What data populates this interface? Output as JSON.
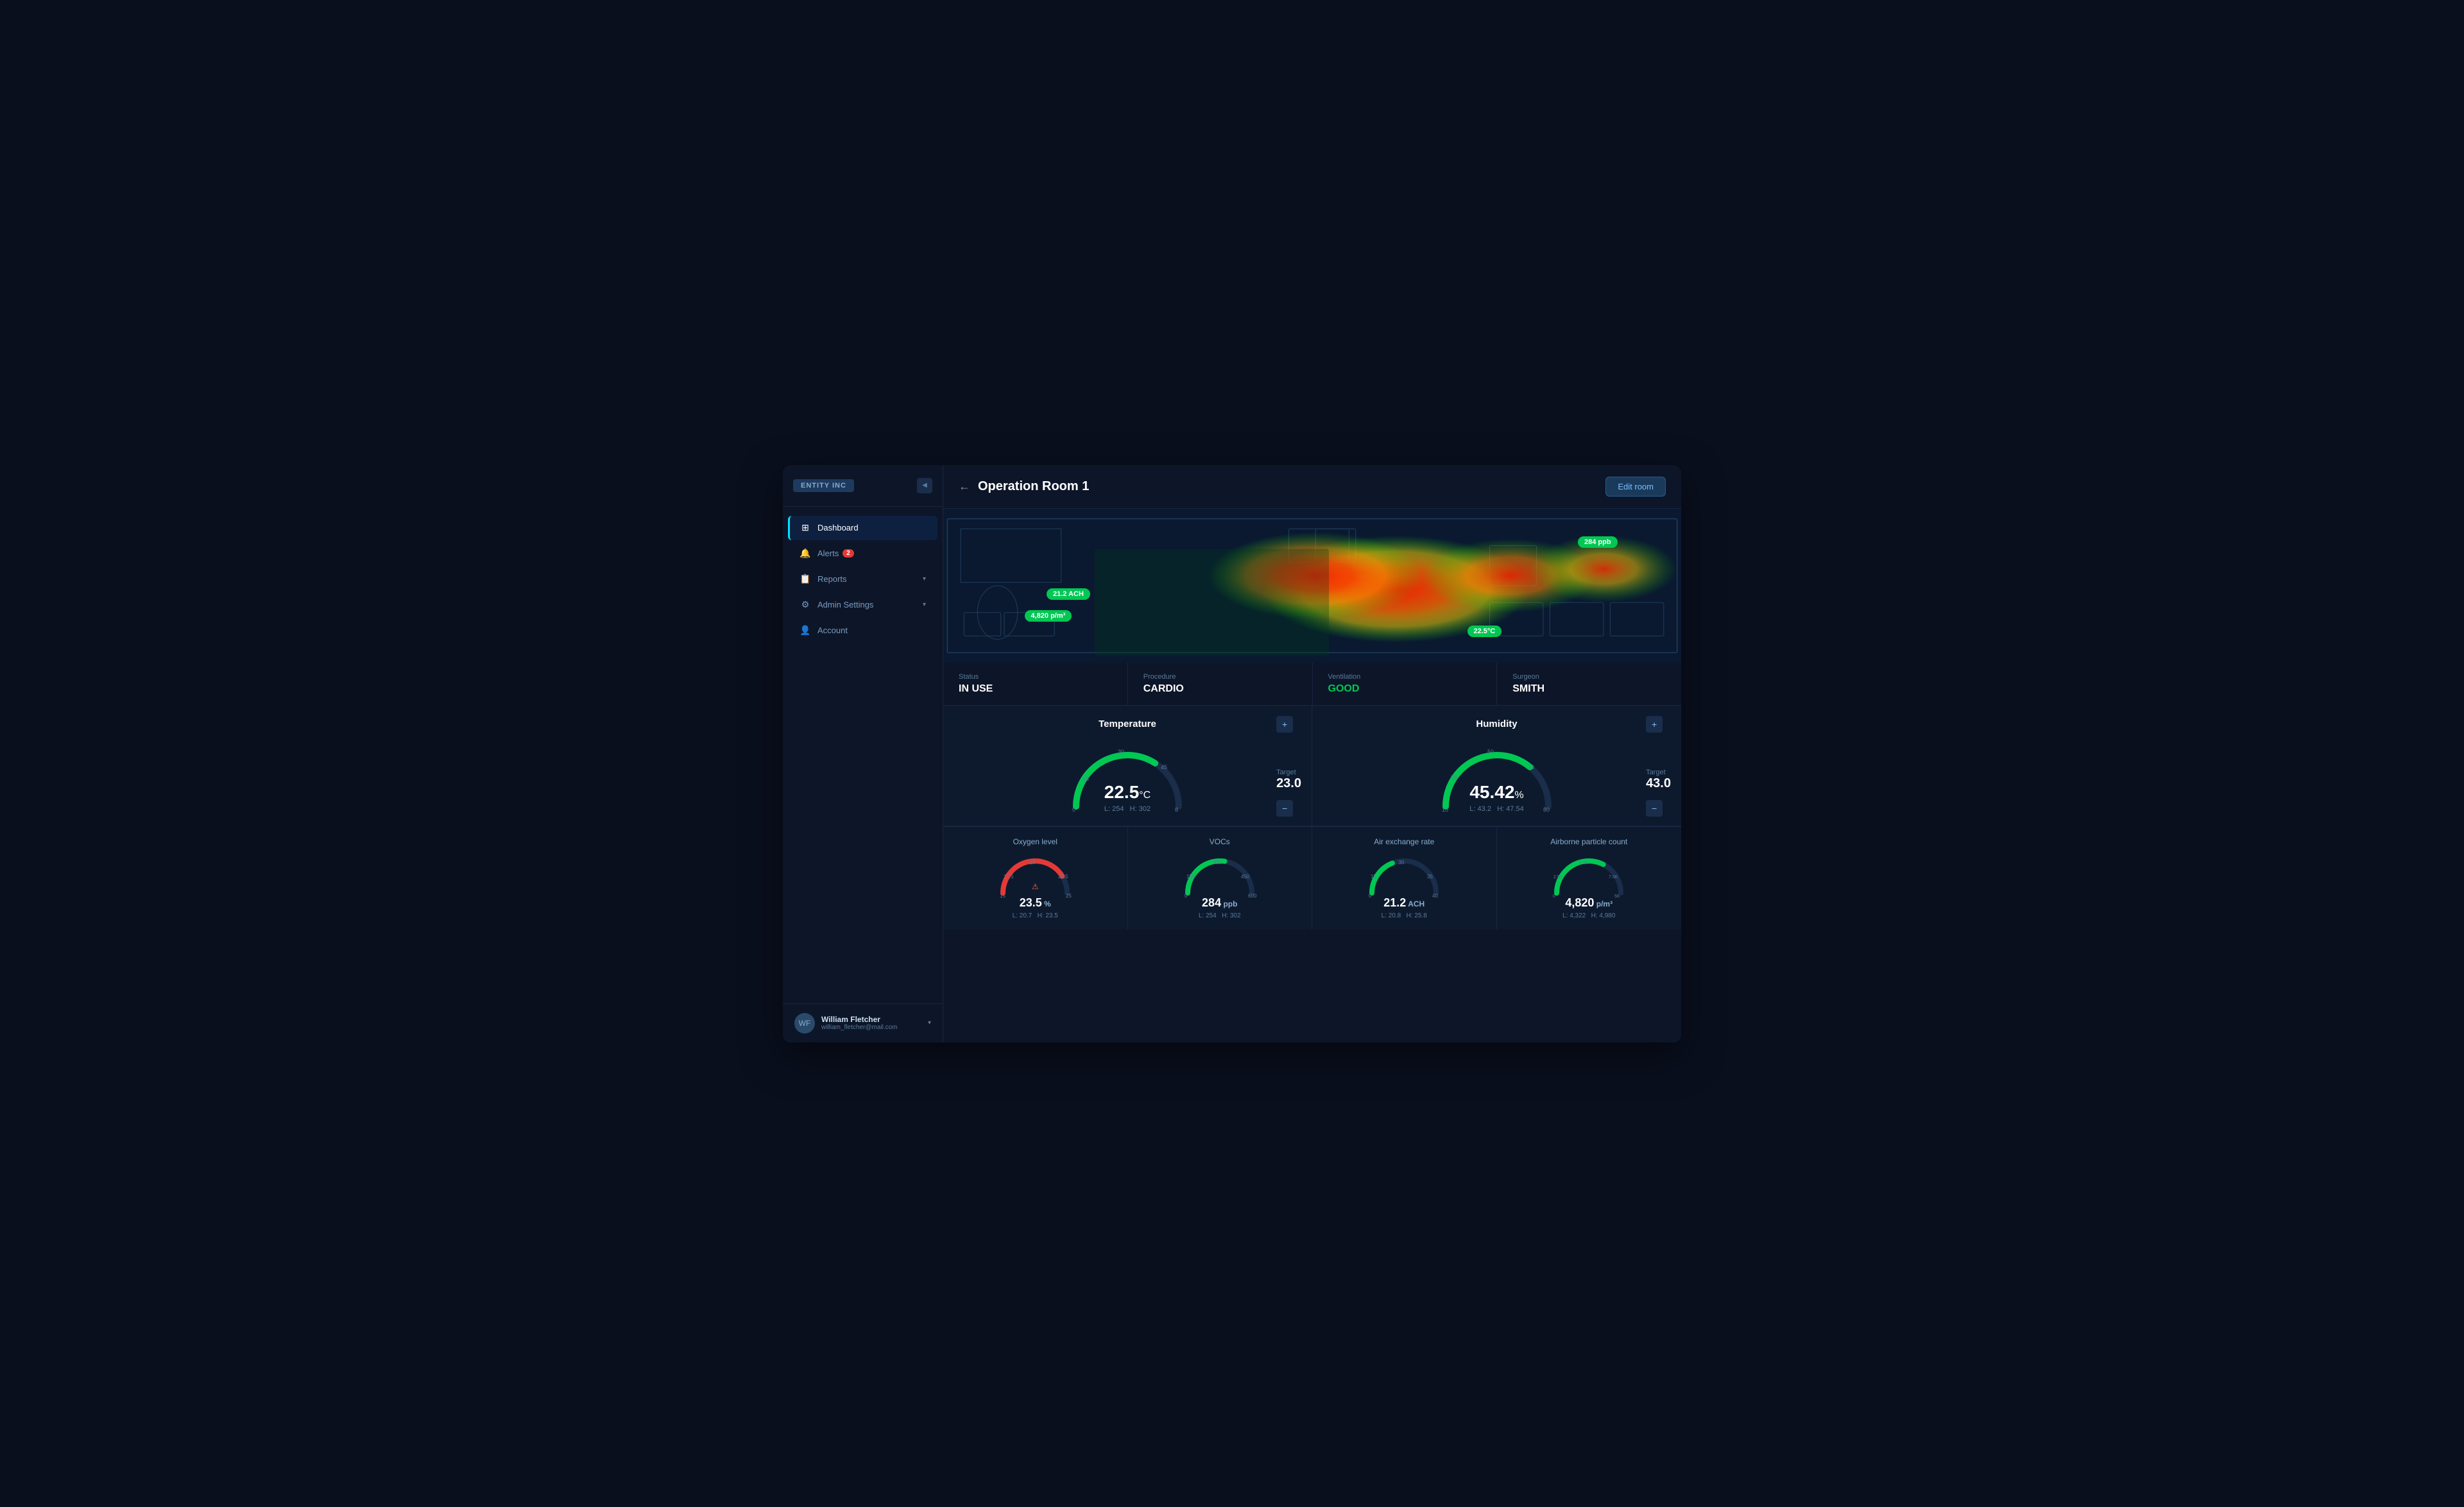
{
  "app": {
    "logo": "ENTITY INC",
    "title": "Operation Room 1",
    "edit_btn": "Edit room"
  },
  "sidebar": {
    "items": [
      {
        "id": "dashboard",
        "label": "Dashboard",
        "icon": "⊞",
        "active": true
      },
      {
        "id": "alerts",
        "label": "Alerts",
        "icon": "🔔",
        "badge": "2"
      },
      {
        "id": "reports",
        "label": "Reports",
        "icon": "⊟",
        "chevron": "▾"
      },
      {
        "id": "admin",
        "label": "Admin Settings",
        "icon": "⊟",
        "chevron": "▾"
      },
      {
        "id": "account",
        "label": "Account",
        "icon": "👤"
      }
    ]
  },
  "user": {
    "name": "William Fletcher",
    "email": "william_fletcher@mail.com",
    "initials": "WF"
  },
  "heatmap": {
    "badge1": {
      "label": "21.2 ACH",
      "left": "14%",
      "top": "52%"
    },
    "badge2": {
      "label": "4,820 p/m³",
      "left": "12%",
      "top": "66%"
    },
    "badge3": {
      "label": "22.5°C",
      "left": "72%",
      "top": "76%"
    },
    "badge4": {
      "label": "284 ppb",
      "left": "87%",
      "top": "20%"
    }
  },
  "status": [
    {
      "label": "Status",
      "value": "IN USE",
      "class": ""
    },
    {
      "label": "Procedure",
      "value": "CARDIO",
      "class": ""
    },
    {
      "label": "Ventilation",
      "value": "GOOD",
      "class": "good"
    },
    {
      "label": "Surgeon",
      "value": "SMITH",
      "class": ""
    }
  ],
  "temperature": {
    "title": "Temperature",
    "value": "22.5",
    "unit": "°C",
    "low": "254",
    "high": "302",
    "target": "23.0",
    "arc_pct": 0.68
  },
  "humidity": {
    "title": "Humidity",
    "value": "45.42",
    "unit": "%",
    "low": "43.2",
    "high": "47.54",
    "target": "43.0",
    "arc_pct": 0.72
  },
  "small_gauges": [
    {
      "title": "Oxygen level",
      "value": "23.5",
      "unit": "%",
      "low": "20.7",
      "high": "23.5",
      "warning": true,
      "arc_pct": 0.82,
      "color": "#e53935"
    },
    {
      "title": "VOCs",
      "value": "284",
      "unit": "ppb",
      "low": "254",
      "high": "302",
      "warning": false,
      "arc_pct": 0.55,
      "color": "#00c853"
    },
    {
      "title": "Air exchange rate",
      "value": "21.2",
      "unit": "ACH",
      "low": "20.8",
      "high": "25.8",
      "warning": false,
      "arc_pct": 0.38,
      "color": "#00c853"
    },
    {
      "title": "Airborne particle count",
      "value": "4,820",
      "unit": "p/m³",
      "low": "4,322",
      "high": "4,980",
      "warning": false,
      "arc_pct": 0.65,
      "color": "#00c853"
    }
  ]
}
